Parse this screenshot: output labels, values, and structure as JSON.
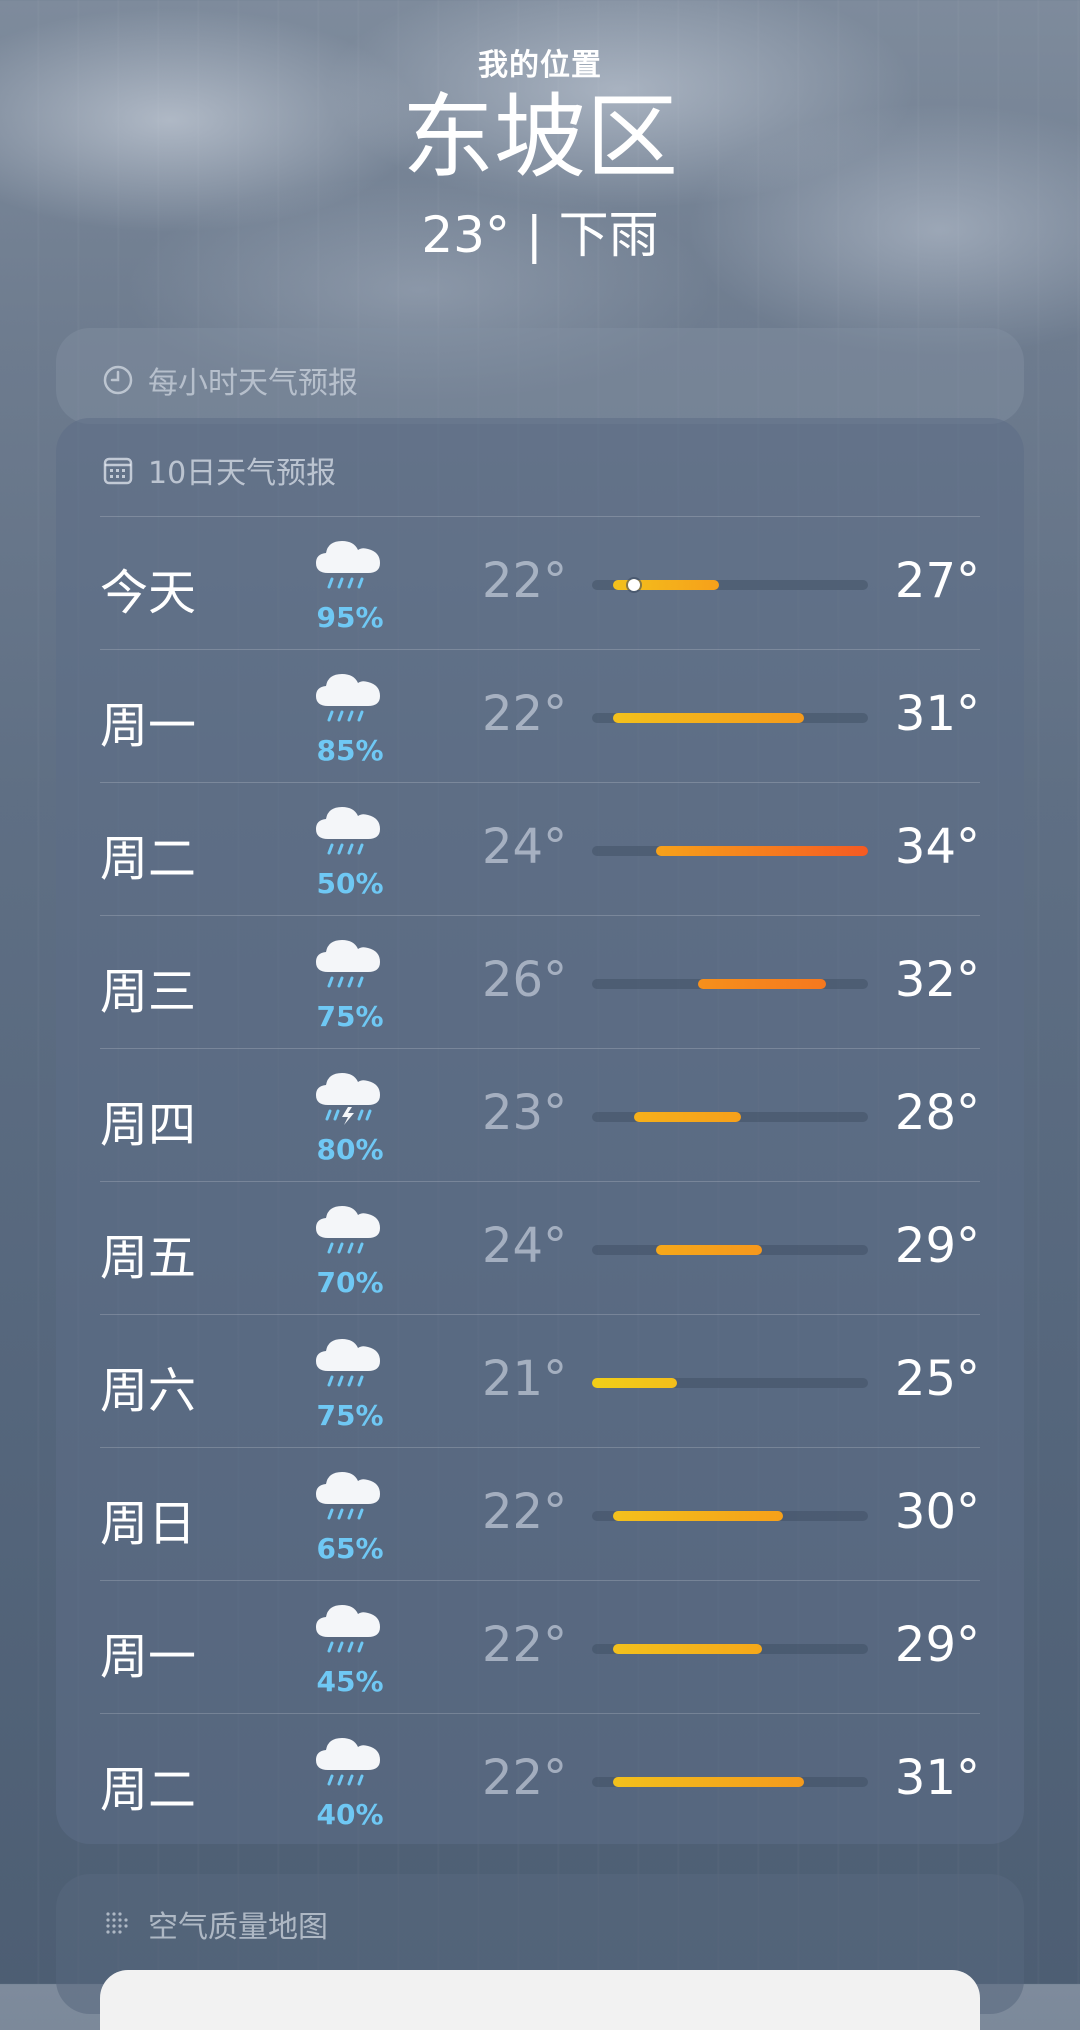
{
  "header": {
    "location_label": "我的位置",
    "city": "东坡区",
    "current": "23° | 下雨"
  },
  "hourly": {
    "title": "每小时天气预报"
  },
  "forecast": {
    "title": "10日天气预报",
    "scale_min": 21,
    "scale_max": 34,
    "current_temp": 23,
    "days": [
      {
        "day": "今天",
        "icon": "rain-cloud-icon",
        "precip": "95%",
        "low": "22°",
        "high": "27°",
        "low_val": 22,
        "high_val": 27,
        "color_from": "#f3c11c",
        "color_to": "#f6a01a",
        "current": true
      },
      {
        "day": "周一",
        "icon": "rain-cloud-icon",
        "precip": "85%",
        "low": "22°",
        "high": "31°",
        "low_val": 22,
        "high_val": 31,
        "color_from": "#f3c11c",
        "color_to": "#f49a1c"
      },
      {
        "day": "周二",
        "icon": "rain-cloud-icon",
        "precip": "50%",
        "low": "24°",
        "high": "34°",
        "low_val": 24,
        "high_val": 34,
        "color_from": "#f7a21a",
        "color_to": "#f55a22"
      },
      {
        "day": "周三",
        "icon": "rain-cloud-icon",
        "precip": "75%",
        "low": "26°",
        "high": "32°",
        "low_val": 26,
        "high_val": 32,
        "color_from": "#f6901c",
        "color_to": "#f5781e"
      },
      {
        "day": "周四",
        "icon": "thunder-rain-icon",
        "precip": "80%",
        "low": "23°",
        "high": "28°",
        "low_val": 23,
        "high_val": 28,
        "color_from": "#f6b01a",
        "color_to": "#f6a01a"
      },
      {
        "day": "周五",
        "icon": "rain-cloud-icon",
        "precip": "70%",
        "low": "24°",
        "high": "29°",
        "low_val": 24,
        "high_val": 29,
        "color_from": "#f6a81a",
        "color_to": "#f6981c"
      },
      {
        "day": "周六",
        "icon": "rain-cloud-icon",
        "precip": "75%",
        "low": "21°",
        "high": "25°",
        "low_val": 21,
        "high_val": 25,
        "color_from": "#f1cf18",
        "color_to": "#f3be1a"
      },
      {
        "day": "周日",
        "icon": "rain-cloud-icon",
        "precip": "65%",
        "low": "22°",
        "high": "30°",
        "low_val": 22,
        "high_val": 30,
        "color_from": "#f3c11c",
        "color_to": "#f6a01a"
      },
      {
        "day": "周一",
        "icon": "rain-cloud-icon",
        "precip": "45%",
        "low": "22°",
        "high": "29°",
        "low_val": 22,
        "high_val": 29,
        "color_from": "#f3c11c",
        "color_to": "#f6a81a"
      },
      {
        "day": "周二",
        "icon": "rain-cloud-icon",
        "precip": "40%",
        "low": "22°",
        "high": "31°",
        "low_val": 22,
        "high_val": 31,
        "color_from": "#f3c11c",
        "color_to": "#f49a1c"
      }
    ]
  },
  "air_quality": {
    "title": "空气质量地图"
  }
}
